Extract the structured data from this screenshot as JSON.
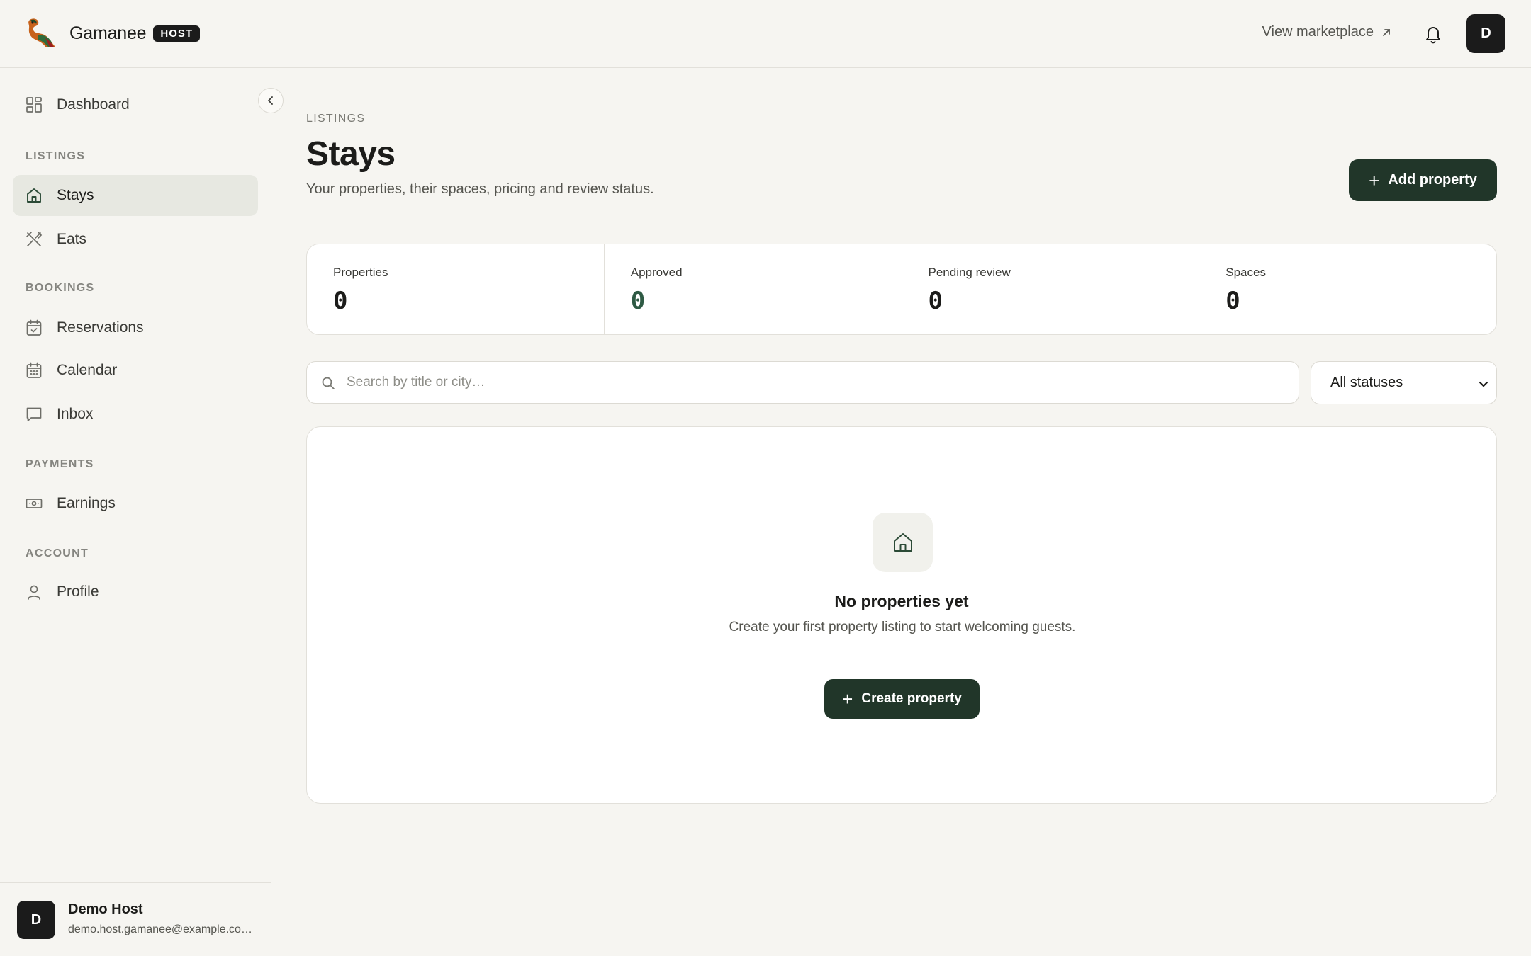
{
  "header": {
    "brand_name": "Gamanee",
    "badge": "HOST",
    "marketplace_link": "View marketplace",
    "avatar_initial": "D",
    "icons": {
      "logo": "gamanee-logo",
      "external": "arrow-up-right-icon",
      "notifications": "bell-icon"
    }
  },
  "sidebar": {
    "dashboard": "Dashboard",
    "sections": {
      "listings": "LISTINGS",
      "bookings": "BOOKINGS",
      "payments": "PAYMENTS",
      "account": "ACCOUNT"
    },
    "items": {
      "stays": "Stays",
      "eats": "Eats",
      "reservations": "Reservations",
      "calendar": "Calendar",
      "inbox": "Inbox",
      "earnings": "Earnings",
      "profile": "Profile"
    },
    "active_item": "stays",
    "user": {
      "initial": "D",
      "name": "Demo Host",
      "email": "demo.host.gamanee@example.co…"
    }
  },
  "main": {
    "eyebrow": "LISTINGS",
    "title": "Stays",
    "subtitle": "Your properties, their spaces, pricing and review status.",
    "add_button": "Add property",
    "stats": [
      {
        "label": "Properties",
        "value": "0"
      },
      {
        "label": "Approved",
        "value": "0"
      },
      {
        "label": "Pending review",
        "value": "0"
      },
      {
        "label": "Spaces",
        "value": "0"
      }
    ],
    "search": {
      "placeholder": "Search by title or city…",
      "value": ""
    },
    "status_filter": {
      "selected": "All statuses"
    },
    "empty": {
      "title": "No properties yet",
      "description": "Create your first property listing to start welcoming guests.",
      "button": "Create property"
    }
  },
  "colors": {
    "accent": "#213629",
    "background": "#f6f5f1",
    "active_nav": "#e7e8e1",
    "approved_value": "#2e5a44"
  }
}
